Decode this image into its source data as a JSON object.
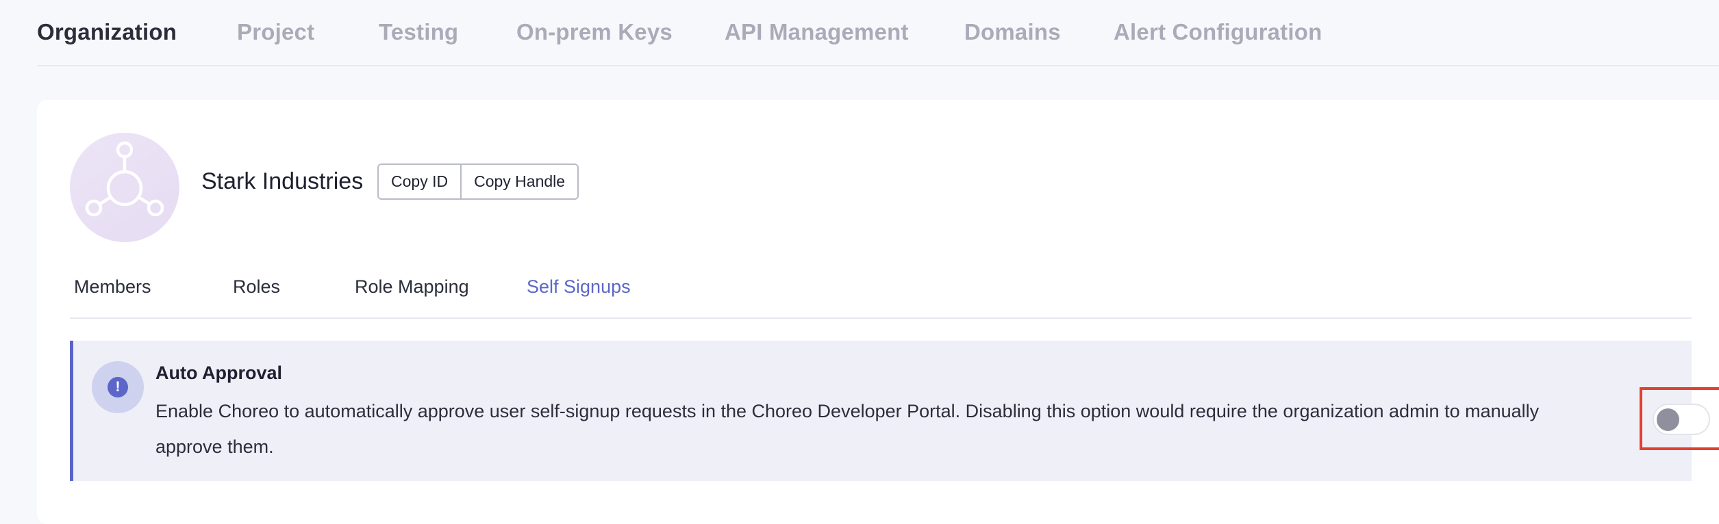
{
  "top_nav": {
    "items": [
      {
        "label": "Organization",
        "active": true
      },
      {
        "label": "Project",
        "active": false
      },
      {
        "label": "Testing",
        "active": false
      },
      {
        "label": "On-prem Keys",
        "active": false
      },
      {
        "label": "API Management",
        "active": false
      },
      {
        "label": "Domains",
        "active": false
      },
      {
        "label": "Alert Configuration",
        "active": false
      }
    ]
  },
  "organization": {
    "avatar_icon": "hub-icon",
    "name": "Stark Industries",
    "copy_id_label": "Copy ID",
    "copy_handle_label": "Copy Handle"
  },
  "sub_tabs": {
    "items": [
      {
        "label": "Members",
        "active": false
      },
      {
        "label": "Roles",
        "active": false
      },
      {
        "label": "Role Mapping",
        "active": false
      },
      {
        "label": "Self Signups",
        "active": true
      }
    ]
  },
  "auto_approval": {
    "icon": "exclamation-icon",
    "badge_glyph": "!",
    "title": "Auto Approval",
    "description": "Enable Choreo to automatically approve user self-signup requests in the Choreo Developer Portal. Disabling this option would require the organization admin to manually approve them.",
    "enabled": false
  },
  "colors": {
    "accent": "#5b67c9",
    "highlight_border": "#e0412d",
    "panel_background": "#efeff8"
  }
}
